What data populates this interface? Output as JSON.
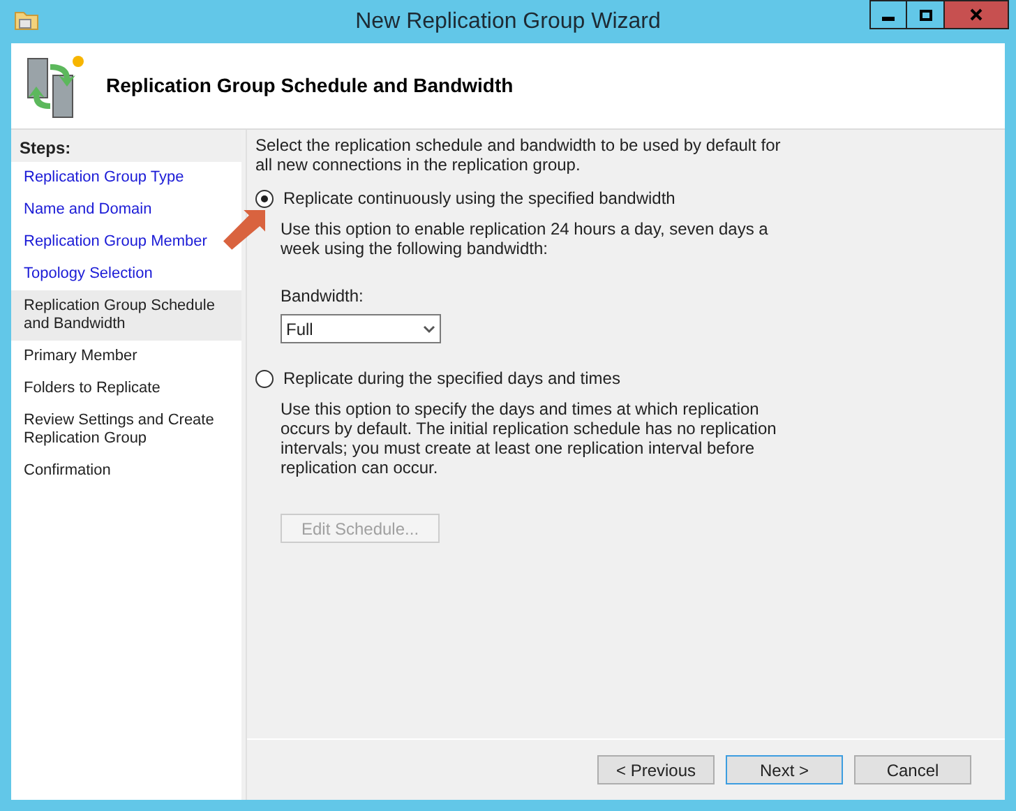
{
  "window": {
    "title": "New Replication Group Wizard"
  },
  "header": {
    "title": "Replication Group Schedule and Bandwidth"
  },
  "steps": {
    "heading": "Steps:",
    "items": [
      {
        "label": "Replication Group Type",
        "completed": true,
        "selected": false
      },
      {
        "label": "Name and Domain",
        "completed": true,
        "selected": false
      },
      {
        "label": "Replication Group Member",
        "completed": true,
        "selected": false
      },
      {
        "label": "Topology Selection",
        "completed": true,
        "selected": false
      },
      {
        "label": "Replication Group Schedule and Bandwidth",
        "completed": false,
        "selected": true
      },
      {
        "label": "Primary Member",
        "completed": false,
        "selected": false
      },
      {
        "label": "Folders to Replicate",
        "completed": false,
        "selected": false
      },
      {
        "label": "Review Settings and Create Replication Group",
        "completed": false,
        "selected": false
      },
      {
        "label": "Confirmation",
        "completed": false,
        "selected": false
      }
    ]
  },
  "content": {
    "intro": "Select the replication schedule and bandwidth to be used by default for all new connections in the replication group.",
    "options": [
      {
        "label": "Replicate continuously using the specified bandwidth",
        "selected": true,
        "description": "Use this option to enable replication 24 hours a day, seven days a week using the following bandwidth:",
        "bandwidth": {
          "label": "Bandwidth:",
          "value": "Full"
        }
      },
      {
        "label": "Replicate during the specified days and times",
        "selected": false,
        "description": "Use this option to specify the days and times at which replication occurs by default. The initial replication schedule has no replication intervals; you must create at least one replication interval before replication can occur.",
        "button": {
          "label": "Edit Schedule...",
          "disabled": true
        }
      }
    ]
  },
  "buttons": [
    {
      "label": "< Previous",
      "focused": false
    },
    {
      "label": "Next >",
      "focused": true
    },
    {
      "label": "Cancel",
      "focused": false
    }
  ]
}
